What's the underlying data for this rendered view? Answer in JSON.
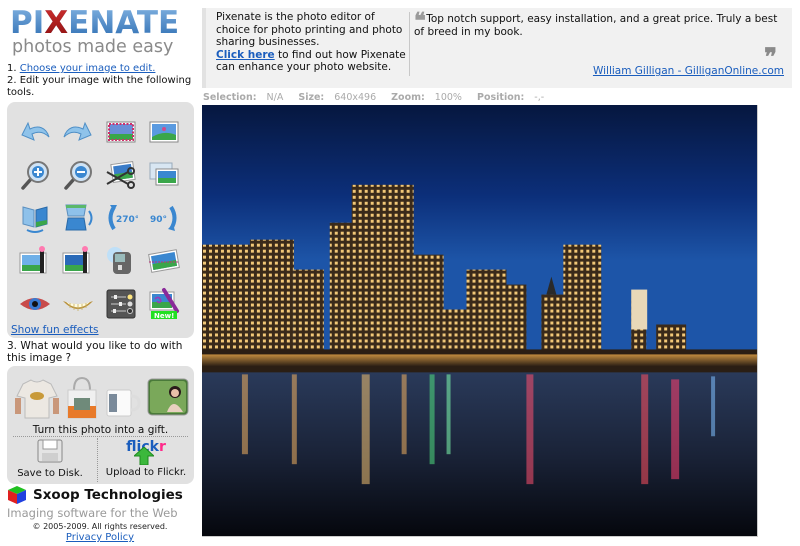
{
  "brand": {
    "logo_pre": "PI",
    "logo_x": "X",
    "logo_post": "ENATE",
    "tagline": "photos made easy"
  },
  "steps": {
    "step1_prefix": "1. ",
    "step1_link": "Choose your image to edit.",
    "step2": "2. Edit your image with the following tools.",
    "step3": "3. What would you like to do with this image ?"
  },
  "tools": {
    "items": [
      {
        "name": "undo",
        "icon": "undo-arrow-icon"
      },
      {
        "name": "redo",
        "icon": "redo-arrow-icon"
      },
      {
        "name": "select-all",
        "icon": "select-all-image-icon"
      },
      {
        "name": "select-none",
        "icon": "select-none-image-icon"
      },
      {
        "name": "zoom-in",
        "icon": "zoom-in-magnifier-icon"
      },
      {
        "name": "zoom-out",
        "icon": "zoom-out-magnifier-icon"
      },
      {
        "name": "crop",
        "icon": "crop-scissors-icon"
      },
      {
        "name": "resize",
        "icon": "resize-image-icon"
      },
      {
        "name": "flip-horizontal",
        "icon": "flip-horizontal-icon"
      },
      {
        "name": "flip-vertical",
        "icon": "flip-vertical-icon"
      },
      {
        "name": "rotate-270",
        "icon": "rotate-270-icon",
        "label": "270°"
      },
      {
        "name": "rotate-90",
        "icon": "rotate-90-icon",
        "label": "90°"
      },
      {
        "name": "enhance",
        "icon": "magic-wand-enhance-icon"
      },
      {
        "name": "fill-flash",
        "icon": "magic-wand-fill-flash-icon"
      },
      {
        "name": "whiten",
        "icon": "lamp-brightness-icon"
      },
      {
        "name": "fix-horizon",
        "icon": "fix-horizon-icon"
      },
      {
        "name": "red-eye",
        "icon": "red-eye-icon"
      },
      {
        "name": "whiten-teeth",
        "icon": "teeth-whiten-icon"
      },
      {
        "name": "adjust",
        "icon": "adjustment-sliders-icon"
      },
      {
        "name": "draw",
        "icon": "draw-crayon-icon",
        "badge": "New!"
      }
    ],
    "fun_effects_link": "Show fun effects"
  },
  "gifts": {
    "label": "Turn this photo into a gift.",
    "items": [
      "t-shirt",
      "tote-bag",
      "mug",
      "photo-print"
    ]
  },
  "actions": {
    "save_label": "Save to Disk.",
    "flickr_logo_a": "flick",
    "flickr_logo_b": "r",
    "flickr_label": "Upload to Flickr."
  },
  "footer": {
    "company": "Sxoop Technologies",
    "tagline": "Imaging software for the Web",
    "copyright": "© 2005-2009. All rights reserved.",
    "privacy": "Privacy Policy"
  },
  "banner": {
    "pitch_text": "Pixenate is the photo editor of choice for photo printing and photo sharing businesses.",
    "pitch_link": "Click here",
    "pitch_tail": " to find out how Pixenate can enhance your photo website.",
    "quote": "Top notch support, easy installation, and a great price. Truly a best of breed in my book.",
    "quote_author": "William Gilligan - GilliganOnline.com"
  },
  "status": {
    "selection_label": "Selection:",
    "selection_value": "N/A",
    "size_label": "Size:",
    "size_value": "640x496",
    "zoom_label": "Zoom:",
    "zoom_value": "100%",
    "position_label": "Position:",
    "position_value": "-,-"
  },
  "photo": {
    "subject": "city-skyline-at-night-over-water"
  },
  "colors": {
    "link": "#1a5dbd",
    "panel_bg": "#e1e1e1",
    "banner_bg": "#f1f1f1",
    "logo_blue": "#3a7bc0",
    "logo_red": "#b21c1c",
    "status_text": "#aaaaaa",
    "new_badge": "#22e022"
  }
}
